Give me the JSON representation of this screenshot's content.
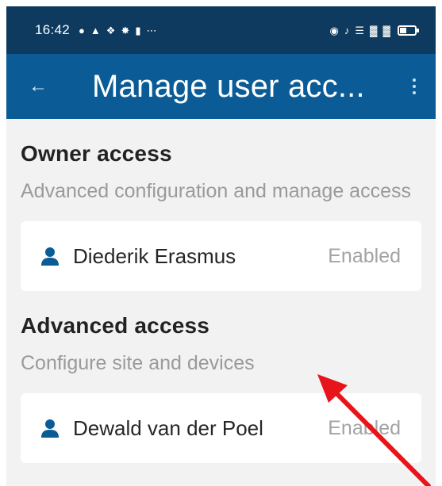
{
  "status_bar": {
    "time": "16:42",
    "left_icons": [
      "chat-icon",
      "bell-icon",
      "app-icon",
      "app-icon-2",
      "battery-saver-icon",
      "more-icon"
    ],
    "right_icons": [
      "eye-icon",
      "mute-icon",
      "wifi-icon",
      "signal-icon",
      "signal-icon-2",
      "battery-icon"
    ]
  },
  "app_bar": {
    "title": "Manage user acc...",
    "back_icon": "back-arrow-icon",
    "menu_icon": "more-vert-icon"
  },
  "sections": [
    {
      "title": "Owner access",
      "description": "Advanced configuration and manage access",
      "users": [
        {
          "name": "Diederik Erasmus",
          "status": "Enabled"
        }
      ]
    },
    {
      "title": "Advanced access",
      "description": "Configure site and devices",
      "users": [
        {
          "name": "Dewald van der Poel",
          "status": "Enabled"
        }
      ]
    }
  ],
  "colors": {
    "status_bar": "#0d3a5e",
    "app_bar": "#0b5c96",
    "background": "#f2f2f2",
    "user_icon": "#0b5c96",
    "annotation_arrow": "#e8141b"
  }
}
